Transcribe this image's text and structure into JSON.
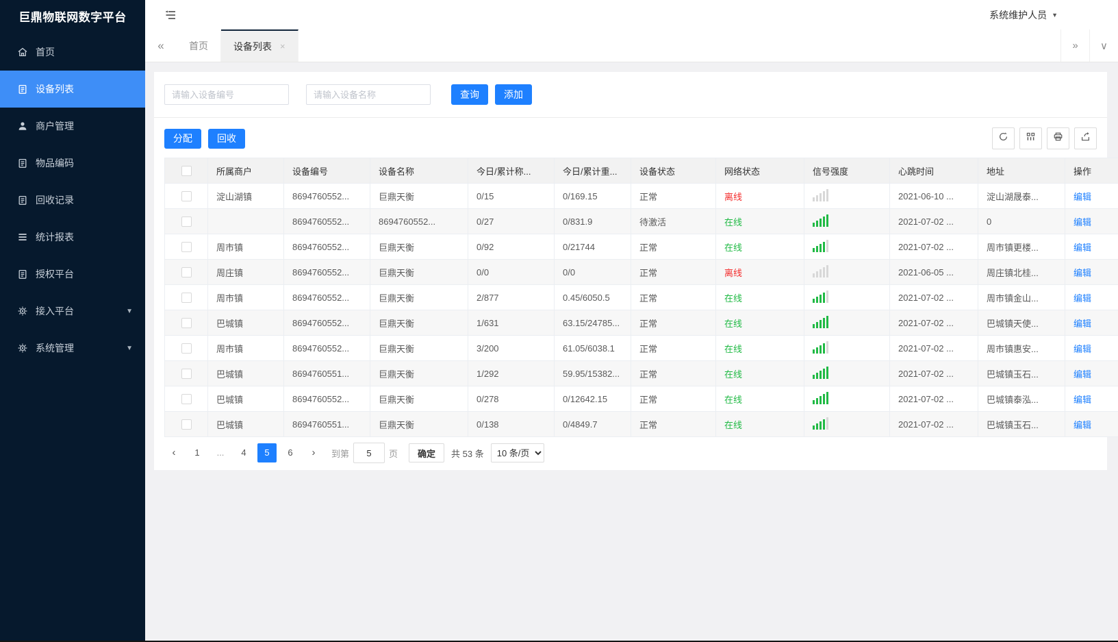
{
  "app": {
    "title": "巨鼎物联网数字平台",
    "user": "系统维护人员"
  },
  "colors": {
    "accent": "#1e80ff",
    "sidebar_bg": "#06192d",
    "sidebar_active": "#3e8ef7",
    "online_green": "#21ba45",
    "offline_red": "#f42c2c"
  },
  "sidebar": {
    "items": [
      {
        "id": "home",
        "icon": "home",
        "label": "首页",
        "active": false,
        "expandable": false
      },
      {
        "id": "device-list",
        "icon": "doc",
        "label": "设备列表",
        "active": true,
        "expandable": false
      },
      {
        "id": "merchant-mgmt",
        "icon": "user",
        "label": "商户管理",
        "active": false,
        "expandable": false
      },
      {
        "id": "item-code",
        "icon": "doc",
        "label": "物品编码",
        "active": false,
        "expandable": false
      },
      {
        "id": "recycle-record",
        "icon": "doc",
        "label": "回收记录",
        "active": false,
        "expandable": false
      },
      {
        "id": "stat-report",
        "icon": "list",
        "label": "统计报表",
        "active": false,
        "expandable": false
      },
      {
        "id": "auth-platform",
        "icon": "doc",
        "label": "授权平台",
        "active": false,
        "expandable": false
      },
      {
        "id": "access-platform",
        "icon": "gear",
        "label": "接入平台",
        "active": false,
        "expandable": true
      },
      {
        "id": "system-mgmt",
        "icon": "gear",
        "label": "系统管理",
        "active": false,
        "expandable": true
      }
    ]
  },
  "tabs": [
    {
      "label": "首页",
      "active": false
    },
    {
      "label": "设备列表",
      "active": true,
      "closable": true
    }
  ],
  "search": {
    "device_no_placeholder": "请输入设备编号",
    "device_name_placeholder": "请输入设备名称",
    "query_label": "查询",
    "add_label": "添加"
  },
  "toolbar": {
    "assign_label": "分配",
    "recycle_label": "回收",
    "icons": [
      "refresh-icon",
      "columns-icon",
      "print-icon",
      "export-icon"
    ]
  },
  "table": {
    "columns": [
      "所属商户",
      "设备编号",
      "设备名称",
      "今日/累计称...",
      "今日/累计重...",
      "设备状态",
      "网络状态",
      "信号强度",
      "心跳时间",
      "地址",
      "操作"
    ],
    "action_label": "编辑",
    "rows": [
      {
        "merchant": "淀山湖镇",
        "device_no": "8694760552...",
        "device_name": "巨鼎天衡",
        "count": "0/15",
        "weight": "0/169.15",
        "status": "正常",
        "network": "离线",
        "online": false,
        "signal": 0,
        "heartbeat": "2021-06-10 ...",
        "address": "淀山湖晟泰..."
      },
      {
        "merchant": "",
        "device_no": "8694760552...",
        "device_name": "8694760552...",
        "count": "0/27",
        "weight": "0/831.9",
        "status": "待激活",
        "network": "在线",
        "online": true,
        "signal": 5,
        "heartbeat": "2021-07-02 ...",
        "address": "0"
      },
      {
        "merchant": "周市镇",
        "device_no": "8694760552...",
        "device_name": "巨鼎天衡",
        "count": "0/92",
        "weight": "0/21744",
        "status": "正常",
        "network": "在线",
        "online": true,
        "signal": 4,
        "heartbeat": "2021-07-02 ...",
        "address": "周市镇更楼..."
      },
      {
        "merchant": "周庄镇",
        "device_no": "8694760552...",
        "device_name": "巨鼎天衡",
        "count": "0/0",
        "weight": "0/0",
        "status": "正常",
        "network": "离线",
        "online": false,
        "signal": 0,
        "heartbeat": "2021-06-05 ...",
        "address": "周庄镇北桂..."
      },
      {
        "merchant": "周市镇",
        "device_no": "8694760552...",
        "device_name": "巨鼎天衡",
        "count": "2/877",
        "weight": "0.45/6050.5",
        "status": "正常",
        "network": "在线",
        "online": true,
        "signal": 4,
        "heartbeat": "2021-07-02 ...",
        "address": "周市镇金山..."
      },
      {
        "merchant": "巴城镇",
        "device_no": "8694760552...",
        "device_name": "巨鼎天衡",
        "count": "1/631",
        "weight": "63.15/24785...",
        "status": "正常",
        "network": "在线",
        "online": true,
        "signal": 5,
        "heartbeat": "2021-07-02 ...",
        "address": "巴城镇天使..."
      },
      {
        "merchant": "周市镇",
        "device_no": "8694760552...",
        "device_name": "巨鼎天衡",
        "count": "3/200",
        "weight": "61.05/6038.1",
        "status": "正常",
        "network": "在线",
        "online": true,
        "signal": 4,
        "heartbeat": "2021-07-02 ...",
        "address": "周市镇惠安..."
      },
      {
        "merchant": "巴城镇",
        "device_no": "8694760551...",
        "device_name": "巨鼎天衡",
        "count": "1/292",
        "weight": "59.95/15382...",
        "status": "正常",
        "network": "在线",
        "online": true,
        "signal": 5,
        "heartbeat": "2021-07-02 ...",
        "address": "巴城镇玉石..."
      },
      {
        "merchant": "巴城镇",
        "device_no": "8694760552...",
        "device_name": "巨鼎天衡",
        "count": "0/278",
        "weight": "0/12642.15",
        "status": "正常",
        "network": "在线",
        "online": true,
        "signal": 5,
        "heartbeat": "2021-07-02 ...",
        "address": "巴城镇泰泓..."
      },
      {
        "merchant": "巴城镇",
        "device_no": "8694760551...",
        "device_name": "巨鼎天衡",
        "count": "0/138",
        "weight": "0/4849.7",
        "status": "正常",
        "network": "在线",
        "online": true,
        "signal": 4,
        "heartbeat": "2021-07-02 ...",
        "address": "巴城镇玉石..."
      }
    ]
  },
  "pagination": {
    "pages": [
      "1",
      "...",
      "4",
      "5",
      "6"
    ],
    "active_page": "5",
    "prev_label": "‹",
    "next_label": "›",
    "goto_label": "到第",
    "goto_value": "5",
    "page_unit_label": "页",
    "confirm_label": "确定",
    "total_label": "共 53 条",
    "page_size": "10 条/页"
  }
}
